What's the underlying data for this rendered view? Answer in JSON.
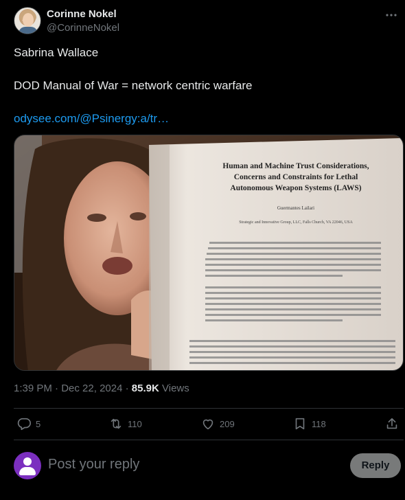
{
  "author": {
    "name": "Corinne Nokel",
    "handle": "@CorinneNokel",
    "more_icon": "ellipsis-icon"
  },
  "post": {
    "line1": "Sabrina Wallace",
    "line2": "DOD Manual of War = network centric warfare",
    "link": "odysee.com/@Psinergy:a/tr…"
  },
  "media": {
    "paper_title_1": "Human and Machine Trust Considerations,",
    "paper_title_2": "Concerns and Constraints for Lethal",
    "paper_title_3": "Autonomous Weapon Systems (LAWS)",
    "paper_author": "Guermantes Lailari",
    "paper_affiliation": "Strategic and Innovative Group, LLC, Falls Church, VA 22046, USA"
  },
  "meta": {
    "time": "1:39 PM",
    "sep": "·",
    "date": "Dec 22, 2024",
    "views_count": "85.9K",
    "views_label": "Views"
  },
  "actions": {
    "replies": "5",
    "reposts": "110",
    "likes": "209",
    "bookmarks": "118"
  },
  "reply_box": {
    "placeholder": "Post your reply",
    "button": "Reply"
  },
  "colors": {
    "background": "#000000",
    "text": "#e7e9ea",
    "muted": "#71767b",
    "link": "#1d9bf0",
    "divider": "#2f3336"
  }
}
